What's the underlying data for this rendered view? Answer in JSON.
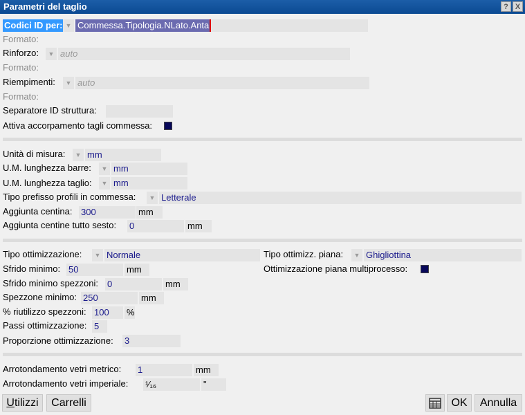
{
  "window": {
    "title": "Parametri del taglio",
    "help_label": "?",
    "close_label": "X"
  },
  "ids": {
    "codici_label": "Codici ID per:",
    "codici_value": "Commessa.Tipologia.NLato.Anta",
    "formato_label": "Formato:",
    "rinforzo_label": "Rinforzo:",
    "rinforzo_placeholder": "auto",
    "riempimenti_label": "Riempimenti:",
    "riempimenti_placeholder": "auto",
    "separatore_label": "Separatore ID struttura:",
    "separatore_value": "",
    "accorpamento_label": "Attiva accorpamento tagli commessa:"
  },
  "misure": {
    "unita_label": "Unità di misura:",
    "unita_value": "mm",
    "um_barre_label": "U.M. lunghezza barre:",
    "um_barre_value": "mm",
    "um_taglio_label": "U.M. lunghezza taglio:",
    "um_taglio_value": "mm",
    "prefisso_label": "Tipo prefisso profili in commessa:",
    "prefisso_value": "Letterale",
    "centina_label": "Aggiunta centina:",
    "centina_value": "300",
    "centina_unit": "mm",
    "centine_ts_label": "Aggiunta centine tutto sesto:",
    "centine_ts_value": "0",
    "centine_ts_unit": "mm"
  },
  "ottimizzazione": {
    "tipo_label": "Tipo ottimizzazione:",
    "tipo_value": "Normale",
    "tipo_piana_label": "Tipo ottimizz. piana:",
    "tipo_piana_value": "Ghigliottina",
    "sfrido_label": "Sfrido minimo:",
    "sfrido_value": "50",
    "sfrido_unit": "mm",
    "multiproc_label": "Ottimizzazione piana multiprocesso:",
    "sfrido_spezzoni_label": "Sfrido minimo spezzoni:",
    "sfrido_spezzoni_value": "0",
    "sfrido_spezzoni_unit": "mm",
    "spezzone_label": "Spezzone minimo:",
    "spezzone_value": "250",
    "spezzone_unit": "mm",
    "riutilizzo_label": "% riutilizzo spezzoni:",
    "riutilizzo_value": "100",
    "riutilizzo_unit": "%",
    "passi_label": "Passi ottimizzazione:",
    "passi_value": "5",
    "proporzione_label": "Proporzione ottimizzazione:",
    "proporzione_value": "3"
  },
  "vetri": {
    "metrico_label": "Arrotondamento vetri metrico:",
    "metrico_value": "1",
    "metrico_unit": "mm",
    "imperiale_label": "Arrotondamento vetri imperiale:",
    "imperiale_value": "¹⁄₁₆",
    "imperiale_unit": "\""
  },
  "footer": {
    "utilizzi_label": "tilizzi",
    "utilizzi_mnemonic": "U",
    "carrelli_label": "Carrelli",
    "ok_label": "OK",
    "annulla_label": "Annulla",
    "icon": "table-icon"
  }
}
